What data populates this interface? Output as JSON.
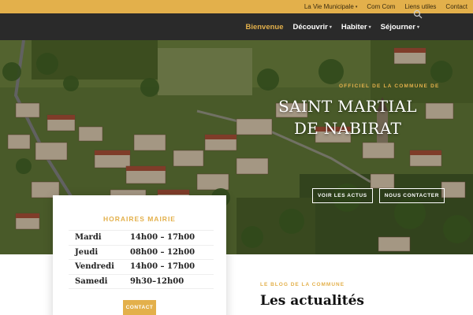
{
  "topbar": {
    "links": [
      "La Vie Municipale",
      "Com Com",
      "Liens utiles",
      "Contact"
    ],
    "dropdown_index": 0
  },
  "nav": {
    "items": [
      {
        "label": "Bienvenue",
        "active": true,
        "dropdown": false
      },
      {
        "label": "Découvrir",
        "active": false,
        "dropdown": true
      },
      {
        "label": "Habiter",
        "active": false,
        "dropdown": true
      },
      {
        "label": "Séjourner",
        "active": false,
        "dropdown": true
      }
    ],
    "search_icon": "search-icon"
  },
  "hero": {
    "subtitle": "OFFICIEL DE LA COMMUNE DE",
    "title": "SAINT MARTIAL DE NABIRAT",
    "buttons": [
      "VOIR LES ACTUS",
      "NOUS CONTACTER"
    ]
  },
  "hours": {
    "title": "HORAIRES MAIRIE",
    "rows": [
      {
        "day": "Mardi",
        "hours": "14h00 – 17h00"
      },
      {
        "day": "Jeudi",
        "hours": "08h00 – 12h00"
      },
      {
        "day": "Vendredi",
        "hours": "14h00 – 17h00"
      },
      {
        "day": "Samedi",
        "hours": "9h30–12h00"
      }
    ],
    "contact_label": "CONTACT"
  },
  "blog": {
    "subtitle": "LE BLOG DE LA COMMUNE",
    "title": "Les actualités"
  },
  "colors": {
    "accent": "#e3b04b",
    "nav_bg": "#2a2a2a"
  }
}
